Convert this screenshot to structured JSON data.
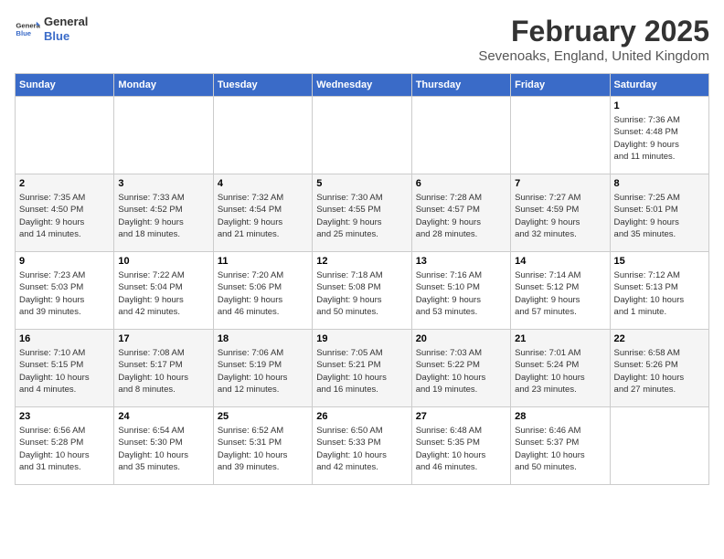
{
  "header": {
    "logo_line1": "General",
    "logo_line2": "Blue",
    "month": "February 2025",
    "location": "Sevenoaks, England, United Kingdom"
  },
  "weekdays": [
    "Sunday",
    "Monday",
    "Tuesday",
    "Wednesday",
    "Thursday",
    "Friday",
    "Saturday"
  ],
  "rows": [
    [
      {
        "day": "",
        "info": ""
      },
      {
        "day": "",
        "info": ""
      },
      {
        "day": "",
        "info": ""
      },
      {
        "day": "",
        "info": ""
      },
      {
        "day": "",
        "info": ""
      },
      {
        "day": "",
        "info": ""
      },
      {
        "day": "1",
        "info": "Sunrise: 7:36 AM\nSunset: 4:48 PM\nDaylight: 9 hours\nand 11 minutes."
      }
    ],
    [
      {
        "day": "2",
        "info": "Sunrise: 7:35 AM\nSunset: 4:50 PM\nDaylight: 9 hours\nand 14 minutes."
      },
      {
        "day": "3",
        "info": "Sunrise: 7:33 AM\nSunset: 4:52 PM\nDaylight: 9 hours\nand 18 minutes."
      },
      {
        "day": "4",
        "info": "Sunrise: 7:32 AM\nSunset: 4:54 PM\nDaylight: 9 hours\nand 21 minutes."
      },
      {
        "day": "5",
        "info": "Sunrise: 7:30 AM\nSunset: 4:55 PM\nDaylight: 9 hours\nand 25 minutes."
      },
      {
        "day": "6",
        "info": "Sunrise: 7:28 AM\nSunset: 4:57 PM\nDaylight: 9 hours\nand 28 minutes."
      },
      {
        "day": "7",
        "info": "Sunrise: 7:27 AM\nSunset: 4:59 PM\nDaylight: 9 hours\nand 32 minutes."
      },
      {
        "day": "8",
        "info": "Sunrise: 7:25 AM\nSunset: 5:01 PM\nDaylight: 9 hours\nand 35 minutes."
      }
    ],
    [
      {
        "day": "9",
        "info": "Sunrise: 7:23 AM\nSunset: 5:03 PM\nDaylight: 9 hours\nand 39 minutes."
      },
      {
        "day": "10",
        "info": "Sunrise: 7:22 AM\nSunset: 5:04 PM\nDaylight: 9 hours\nand 42 minutes."
      },
      {
        "day": "11",
        "info": "Sunrise: 7:20 AM\nSunset: 5:06 PM\nDaylight: 9 hours\nand 46 minutes."
      },
      {
        "day": "12",
        "info": "Sunrise: 7:18 AM\nSunset: 5:08 PM\nDaylight: 9 hours\nand 50 minutes."
      },
      {
        "day": "13",
        "info": "Sunrise: 7:16 AM\nSunset: 5:10 PM\nDaylight: 9 hours\nand 53 minutes."
      },
      {
        "day": "14",
        "info": "Sunrise: 7:14 AM\nSunset: 5:12 PM\nDaylight: 9 hours\nand 57 minutes."
      },
      {
        "day": "15",
        "info": "Sunrise: 7:12 AM\nSunset: 5:13 PM\nDaylight: 10 hours\nand 1 minute."
      }
    ],
    [
      {
        "day": "16",
        "info": "Sunrise: 7:10 AM\nSunset: 5:15 PM\nDaylight: 10 hours\nand 4 minutes."
      },
      {
        "day": "17",
        "info": "Sunrise: 7:08 AM\nSunset: 5:17 PM\nDaylight: 10 hours\nand 8 minutes."
      },
      {
        "day": "18",
        "info": "Sunrise: 7:06 AM\nSunset: 5:19 PM\nDaylight: 10 hours\nand 12 minutes."
      },
      {
        "day": "19",
        "info": "Sunrise: 7:05 AM\nSunset: 5:21 PM\nDaylight: 10 hours\nand 16 minutes."
      },
      {
        "day": "20",
        "info": "Sunrise: 7:03 AM\nSunset: 5:22 PM\nDaylight: 10 hours\nand 19 minutes."
      },
      {
        "day": "21",
        "info": "Sunrise: 7:01 AM\nSunset: 5:24 PM\nDaylight: 10 hours\nand 23 minutes."
      },
      {
        "day": "22",
        "info": "Sunrise: 6:58 AM\nSunset: 5:26 PM\nDaylight: 10 hours\nand 27 minutes."
      }
    ],
    [
      {
        "day": "23",
        "info": "Sunrise: 6:56 AM\nSunset: 5:28 PM\nDaylight: 10 hours\nand 31 minutes."
      },
      {
        "day": "24",
        "info": "Sunrise: 6:54 AM\nSunset: 5:30 PM\nDaylight: 10 hours\nand 35 minutes."
      },
      {
        "day": "25",
        "info": "Sunrise: 6:52 AM\nSunset: 5:31 PM\nDaylight: 10 hours\nand 39 minutes."
      },
      {
        "day": "26",
        "info": "Sunrise: 6:50 AM\nSunset: 5:33 PM\nDaylight: 10 hours\nand 42 minutes."
      },
      {
        "day": "27",
        "info": "Sunrise: 6:48 AM\nSunset: 5:35 PM\nDaylight: 10 hours\nand 46 minutes."
      },
      {
        "day": "28",
        "info": "Sunrise: 6:46 AM\nSunset: 5:37 PM\nDaylight: 10 hours\nand 50 minutes."
      },
      {
        "day": "",
        "info": ""
      }
    ]
  ]
}
